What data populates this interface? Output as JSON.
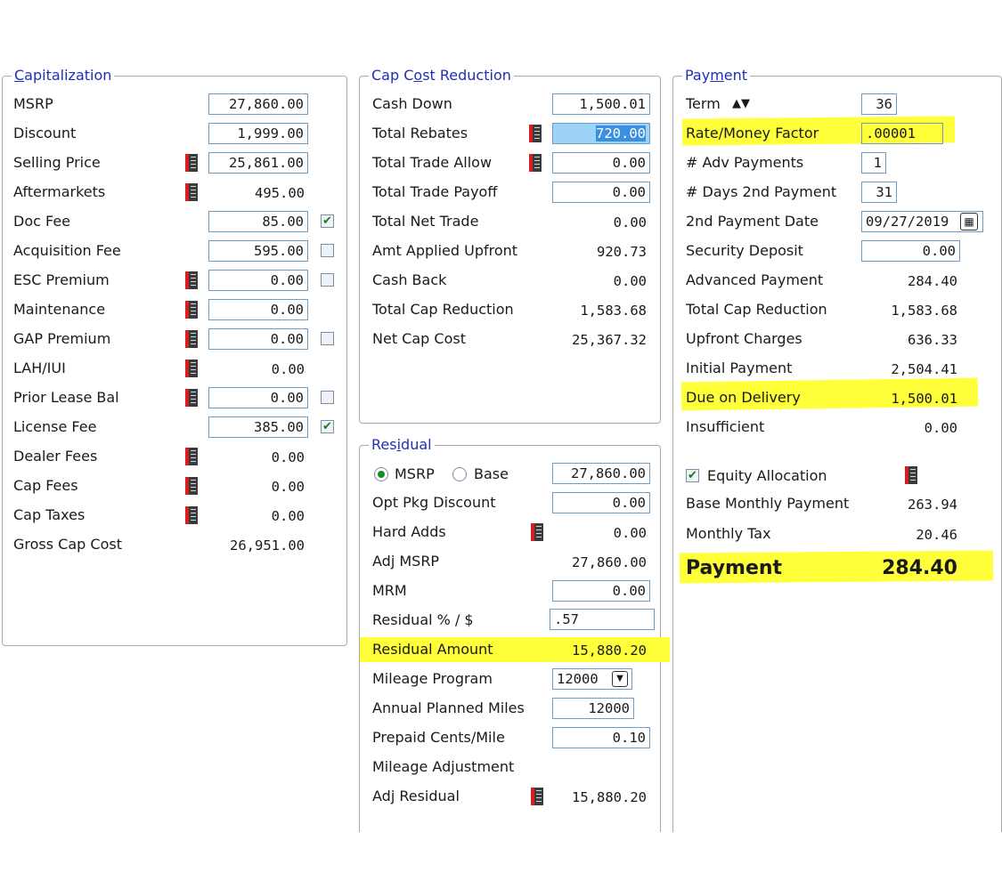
{
  "capitalization": {
    "title": "Capitalization",
    "rows": [
      {
        "label": "MSRP",
        "value": "27,860.00"
      },
      {
        "label": "Discount",
        "value": "1,999.00"
      },
      {
        "label": "Selling Price",
        "value": "25,861.00"
      },
      {
        "label": "Aftermarkets",
        "value": "495.00"
      },
      {
        "label": "Doc Fee",
        "value": "85.00"
      },
      {
        "label": "Acquisition Fee",
        "value": "595.00"
      },
      {
        "label": "ESC Premium",
        "value": "0.00"
      },
      {
        "label": "Maintenance",
        "value": "0.00"
      },
      {
        "label": "GAP Premium",
        "value": "0.00"
      },
      {
        "label": "LAH/IUI",
        "value": "0.00"
      },
      {
        "label": "Prior Lease Bal",
        "value": "0.00"
      },
      {
        "label": "License Fee",
        "value": "385.00"
      },
      {
        "label": "Dealer Fees",
        "value": "0.00"
      },
      {
        "label": "Cap Fees",
        "value": "0.00"
      },
      {
        "label": "Cap Taxes",
        "value": "0.00"
      },
      {
        "label": "Gross Cap Cost",
        "value": "26,951.00"
      }
    ]
  },
  "cap_cost_reduction": {
    "title": "Cap Cost Reduction",
    "rows": [
      {
        "label": "Cash Down",
        "value": "1,500.01"
      },
      {
        "label": "Total Rebates",
        "value": "720.00"
      },
      {
        "label": "Total Trade Allow",
        "value": "0.00"
      },
      {
        "label": "Total Trade Payoff",
        "value": "0.00"
      },
      {
        "label": "Total Net Trade",
        "value": "0.00"
      },
      {
        "label": "Amt Applied Upfront",
        "value": "920.73"
      },
      {
        "label": "Cash Back",
        "value": "0.00"
      },
      {
        "label": "Total Cap Reduction",
        "value": "1,583.68"
      },
      {
        "label": "Net Cap Cost",
        "value": "25,367.32"
      }
    ]
  },
  "residual": {
    "title": "Residual",
    "radio_msrp": "MSRP",
    "radio_base": "Base",
    "base_value": "27,860.00",
    "rows": [
      {
        "label": "Opt Pkg Discount",
        "value": "0.00"
      },
      {
        "label": "Hard Adds",
        "value": "0.00"
      },
      {
        "label": "Adj MSRP",
        "value": "27,860.00"
      },
      {
        "label": "MRM",
        "value": "0.00"
      },
      {
        "label": "Residual % / $",
        "value": ".57"
      },
      {
        "label": "Residual Amount",
        "value": "15,880.20"
      },
      {
        "label": "Mileage Program",
        "value": "12000"
      },
      {
        "label": "Annual Planned Miles",
        "value": "12000"
      },
      {
        "label": "Prepaid Cents/Mile",
        "value": "0.10"
      },
      {
        "label": "Mileage Adjustment",
        "value": ""
      },
      {
        "label": "Adj Residual",
        "value": "15,880.20"
      }
    ]
  },
  "payment": {
    "title": "Payment",
    "rows": [
      {
        "label": "Term",
        "value": "36"
      },
      {
        "label": "Rate/Money Factor",
        "value": ".00001"
      },
      {
        "label": "# Adv Payments",
        "value": "1"
      },
      {
        "label": "# Days 2nd Payment",
        "value": "31"
      },
      {
        "label": "2nd Payment Date",
        "value": "09/27/2019"
      },
      {
        "label": "Security Deposit",
        "value": "0.00"
      },
      {
        "label": "Advanced Payment",
        "value": "284.40"
      },
      {
        "label": "Total Cap Reduction",
        "value": "1,583.68"
      },
      {
        "label": "Upfront Charges",
        "value": "636.33"
      },
      {
        "label": "Initial Payment",
        "value": "2,504.41"
      },
      {
        "label": "Due on Delivery",
        "value": "1,500.01"
      },
      {
        "label": "Insufficient",
        "value": "0.00"
      }
    ],
    "equity_allocation": "Equity Allocation",
    "base_monthly_label": "Base Monthly Payment",
    "base_monthly_value": "263.94",
    "monthly_tax_label": "Monthly Tax",
    "monthly_tax_value": "20.46",
    "payment_label": "Payment",
    "payment_value": "284.40"
  },
  "colors": {
    "legend": "#1f2fb8",
    "highlight": "#ffff3a",
    "input_border": "#6f9bc9"
  }
}
